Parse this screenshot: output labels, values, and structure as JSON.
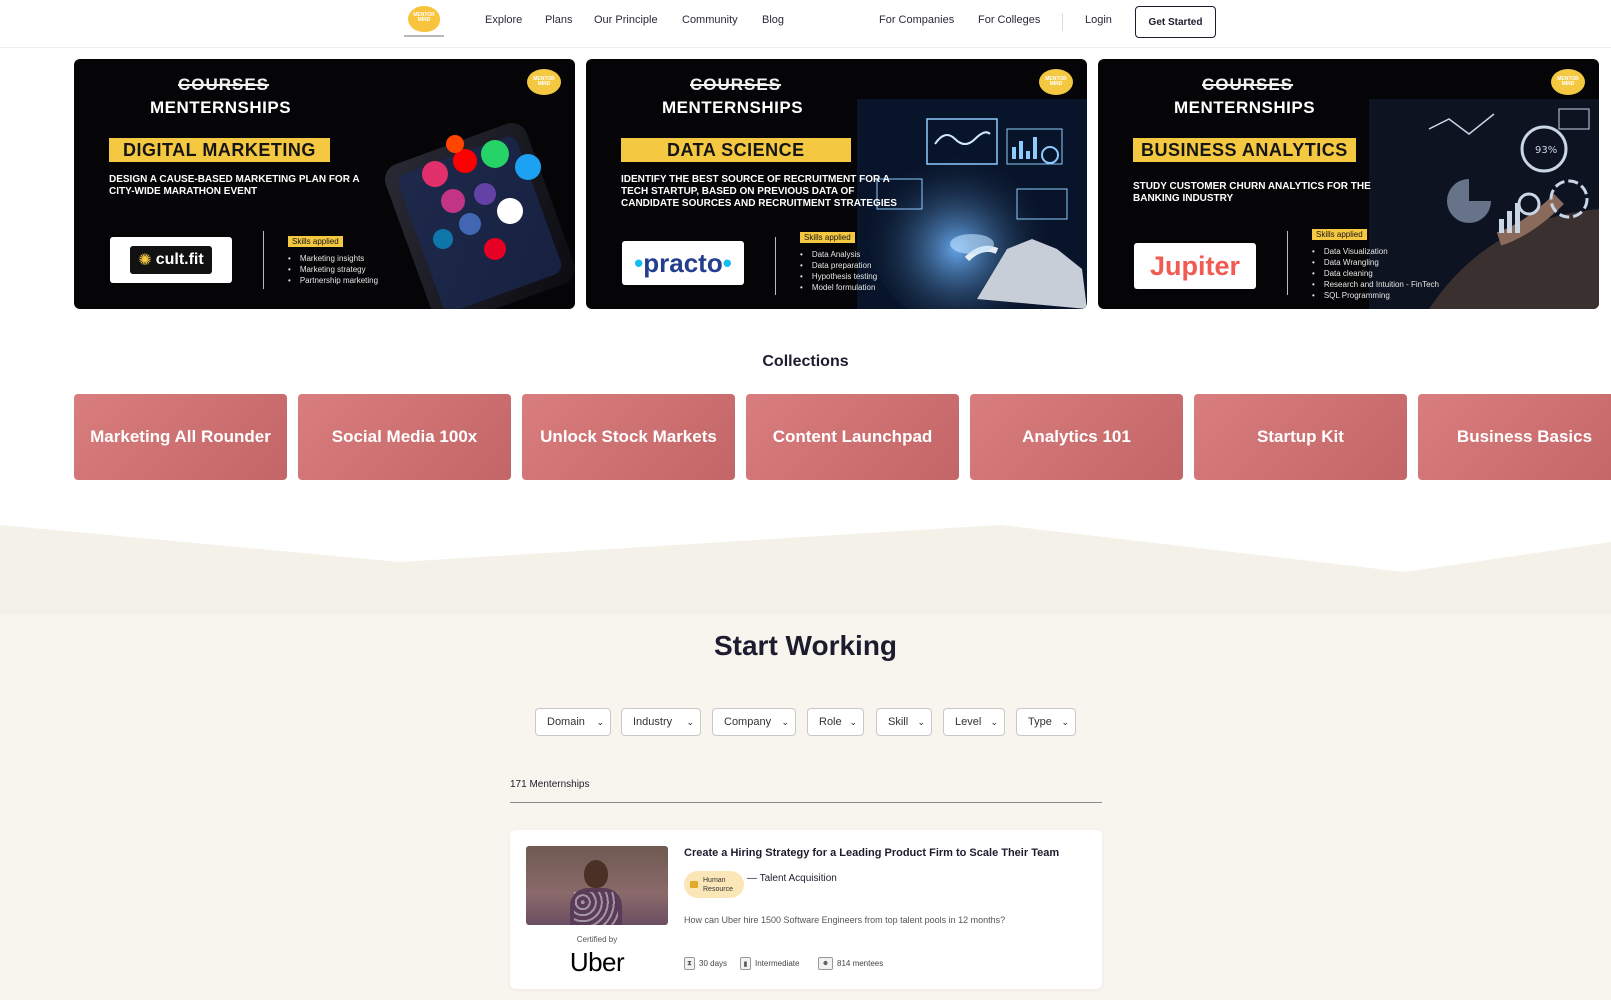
{
  "nav": {
    "logo_text": "MENTOR MIND",
    "links": [
      "Explore",
      "Plans",
      "Our Principle",
      "Community",
      "Blog"
    ],
    "right_links": [
      "For Companies",
      "For Colleges",
      "Login"
    ],
    "cta": "Get Started"
  },
  "banners": [
    {
      "strike": "COURSES",
      "heading": "MENTERNSHIPS",
      "tag": "DIGITAL MARKETING",
      "description": "DESIGN A CAUSE-BASED MARKETING PLAN FOR A CITY-WIDE MARATHON EVENT",
      "company": "cult.fit",
      "skills_label": "Skills applied",
      "skills": [
        "Marketing insights",
        "Marketing strategy",
        "Partnership marketing"
      ]
    },
    {
      "strike": "COURSES",
      "heading": "MENTERNSHIPS",
      "tag": "DATA SCIENCE",
      "description": "IDENTIFY THE BEST SOURCE OF RECRUITMENT FOR A TECH STARTUP, BASED ON PREVIOUS DATA OF CANDIDATE SOURCES AND RECRUITMENT STRATEGIES",
      "company": "practo",
      "skills_label": "Skills applied",
      "skills": [
        "Data Analysis",
        "Data preparation",
        "Hypothesis testing",
        "Model formulation"
      ]
    },
    {
      "strike": "COURSES",
      "heading": "MENTERNSHIPS",
      "tag": "BUSINESS ANALYTICS",
      "description": "STUDY CUSTOMER CHURN ANALYTICS FOR THE BANKING INDUSTRY",
      "company": "Jupiter",
      "skills_label": "Skills applied",
      "skills": [
        "Data Visualization",
        "Data Wrangling",
        "Data cleaning",
        "Research and Intuition - FinTech",
        "SQL Programming"
      ]
    }
  ],
  "collections": {
    "title": "Collections",
    "items": [
      "Marketing All Rounder",
      "Social Media 100x",
      "Unlock Stock Markets",
      "Content Launchpad",
      "Analytics 101",
      "Startup Kit",
      "Business Basics"
    ]
  },
  "start_working": {
    "title": "Start Working",
    "filters": [
      "Domain",
      "Industry",
      "Company",
      "Role",
      "Skill",
      "Level",
      "Type"
    ],
    "count": "171 Menternships"
  },
  "card": {
    "title": "Create a Hiring Strategy for a Leading Product Firm to Scale Their Team",
    "domain": "Human Resource",
    "role": "— Talent Acquisition",
    "description": "How can Uber hire 1500 Software Engineers from top talent pools in 12 months?",
    "certified_label": "Certified by",
    "company": "Uber",
    "duration": "30 days",
    "level": "Intermediate",
    "mentees": "814 mentees"
  },
  "colors": {
    "accent_yellow": "#f5c842",
    "collection_card": "#d46e70",
    "beige_bg": "#f8f5ee",
    "dark_text": "#1c1c2e"
  }
}
